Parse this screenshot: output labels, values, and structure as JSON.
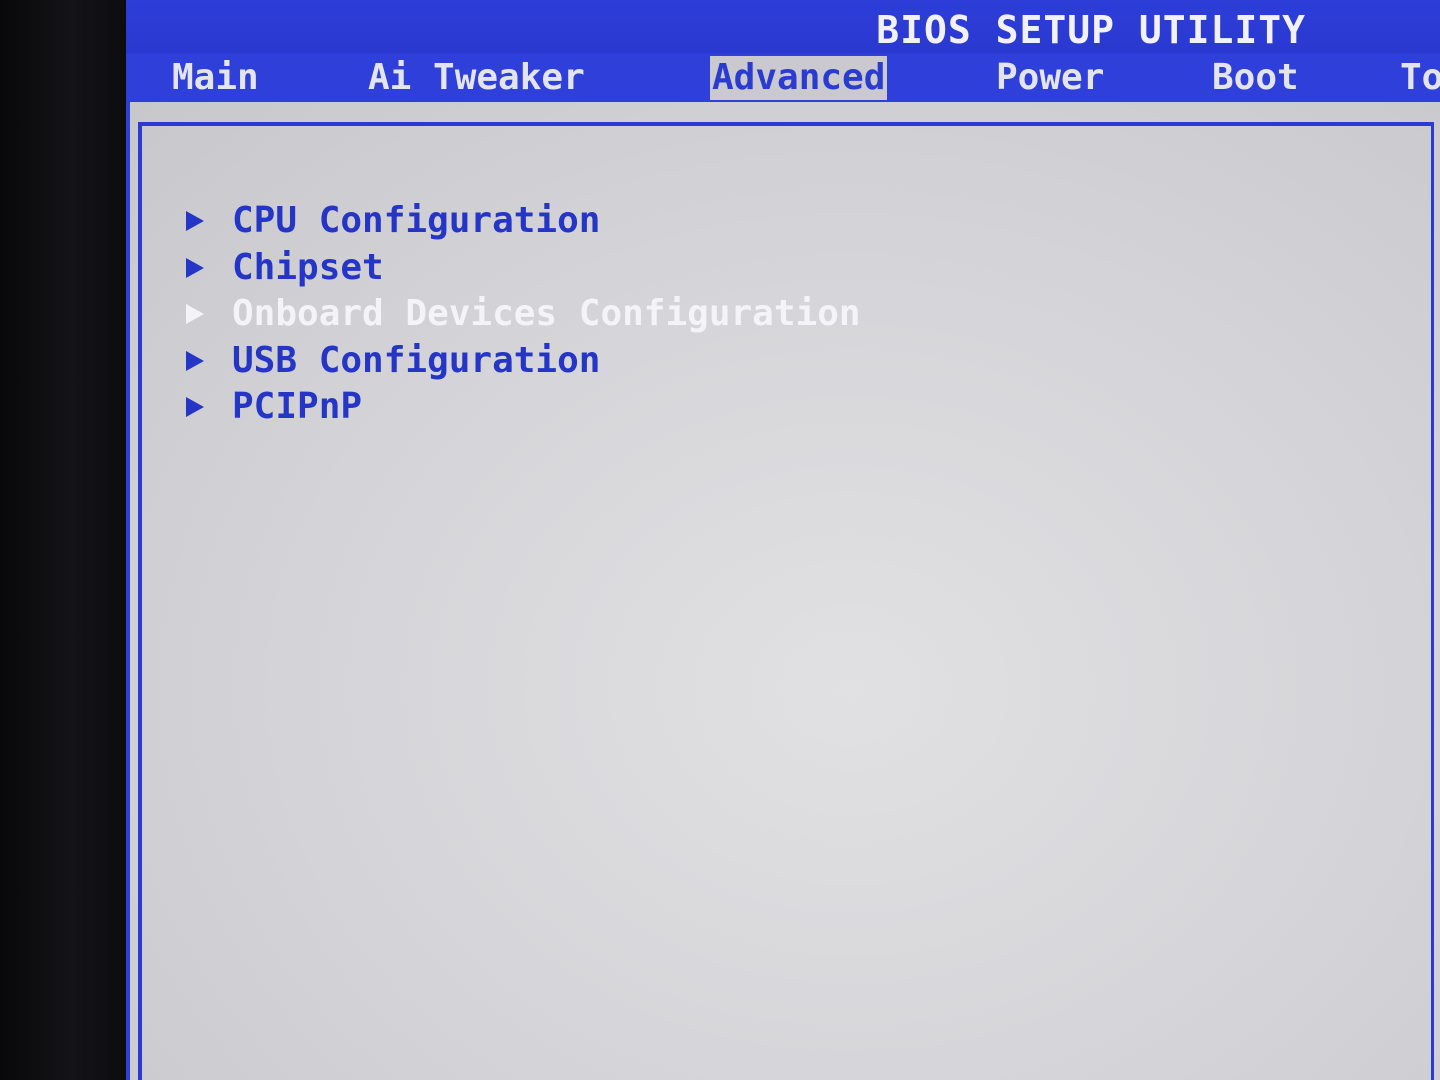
{
  "header": {
    "title": "BIOS SETUP UTILITY"
  },
  "tabs": [
    {
      "label": "Main"
    },
    {
      "label": "Ai Tweaker"
    },
    {
      "label": "Advanced",
      "active": true
    },
    {
      "label": "Power"
    },
    {
      "label": "Boot"
    },
    {
      "label": "To"
    }
  ],
  "menu": {
    "items": [
      {
        "label": "CPU Configuration",
        "icon": "triangle-right-icon"
      },
      {
        "label": "Chipset",
        "icon": "triangle-right-icon"
      },
      {
        "label": "Onboard Devices Configuration",
        "icon": "triangle-right-icon",
        "selected": true
      },
      {
        "label": "USB Configuration",
        "icon": "triangle-right-icon"
      },
      {
        "label": "PCIPnP",
        "icon": "triangle-right-icon"
      }
    ]
  },
  "colors": {
    "header_blue": "#2e3fd6",
    "menu_text": "#2536c6",
    "content_bg": "#d4d4d8",
    "highlight_text": "#f4f4f8",
    "active_tab_bg": "#c9c9cf"
  }
}
